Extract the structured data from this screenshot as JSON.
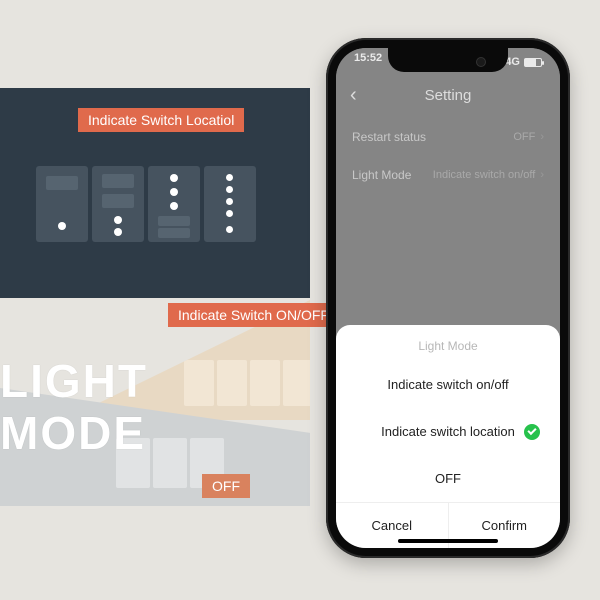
{
  "promo": {
    "tag_location": "Indicate Switch Locatiol",
    "tag_onoff": "Indicate Switch ON/OFF",
    "tag_off": "OFF",
    "title_line1": "LIGHT",
    "title_line2": "MODE"
  },
  "statusbar": {
    "time": "15:52",
    "network": "4G"
  },
  "nav": {
    "back_glyph": "‹",
    "title": "Setting"
  },
  "settings": {
    "restart_label": "Restart status",
    "restart_value": "OFF",
    "lightmode_label": "Light Mode",
    "lightmode_value": "Indicate switch on/off",
    "chevron": "›"
  },
  "sheet": {
    "title": "Light Mode",
    "opt_onoff": "Indicate switch on/off",
    "opt_location": "Indicate switch location",
    "opt_off": "OFF",
    "cancel": "Cancel",
    "confirm": "Confirm"
  }
}
